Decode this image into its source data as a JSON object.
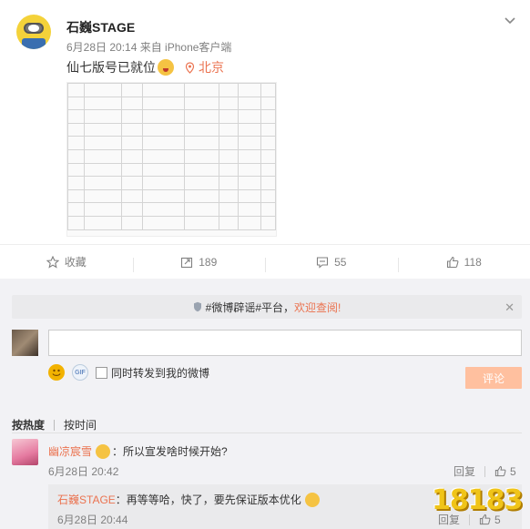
{
  "post": {
    "author": "石巍STAGE",
    "meta": "6月28日 20:14 来自 iPhone客户端",
    "text": "仙七版号已就位",
    "location": "北京"
  },
  "actions": {
    "favorite": "收藏",
    "repost_count": "189",
    "comment_count": "55",
    "like_count": "118"
  },
  "comment_panel": {
    "notice_prefix": "#微博辟谣#平台，",
    "notice_link": "欢迎查阅!",
    "notice_close": "✕",
    "repost_checkbox_label": "同时转发到我的微博",
    "submit_label": "评论",
    "gif_label": "GIF",
    "sort_hot": "按热度",
    "sort_time": "按时间"
  },
  "comments": [
    {
      "user": "幽凉宸雪",
      "text": "：所以宣发啥时候开始?",
      "time": "6月28日 20:42",
      "reply_label": "回复",
      "likes": "5",
      "reply": {
        "user": "石巍STAGE",
        "text": "：再等等哈，快了，要先保证版本优化",
        "time": "6月28日 20:44",
        "reply_label": "回复",
        "likes": "5"
      }
    }
  ],
  "watermark": "18183"
}
